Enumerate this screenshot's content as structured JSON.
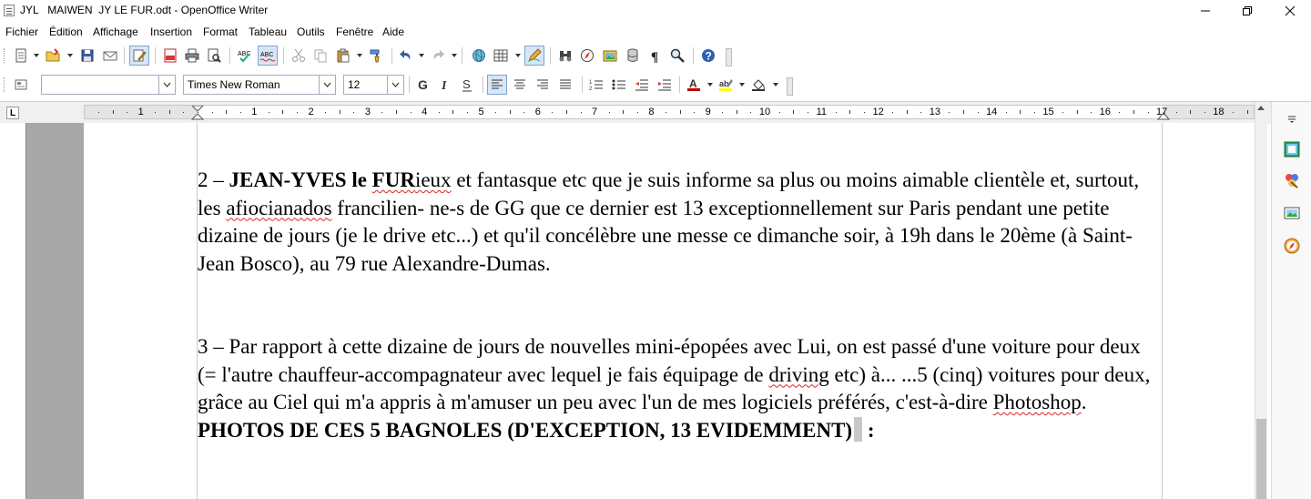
{
  "window": {
    "title": "JYL   MAIWEN  JY LE FUR.odt - OpenOffice Writer"
  },
  "menu": [
    "Fichier",
    "Édition",
    "Affichage",
    "Insertion",
    "Format",
    "Tableau",
    "Outils",
    "Fenêtre",
    "Aide"
  ],
  "formatting": {
    "style_value": "",
    "font_name": "Times New Roman",
    "font_size": "12"
  },
  "ruler": {
    "labels": [
      "1",
      "1",
      "2",
      "3",
      "4",
      "5",
      "6",
      "7",
      "8",
      "9",
      "10",
      "11",
      "12",
      "13",
      "14",
      "15",
      "16",
      "17",
      "18"
    ]
  },
  "document": {
    "p2": {
      "lead": "2 – ",
      "bold": "JEAN-YVES le ",
      "bold_squiggle": "FUR",
      "squiggle_rest": "ieux",
      "text1": " et fantasque etc que je suis informe sa plus ou moins aimable clientèle et, surtout, les ",
      "squiggle2": "afiocianados",
      "text2": " francilien- ne-s de GG que ce dernier est 13 exceptionnellement sur Paris pendant une petite dizaine de jours (je le drive etc...) et qu'il concélèbre une messe ce dimanche soir, à 19h dans le 20ème (à Saint-Jean Bosco), au 79 rue Alexandre-Dumas."
    },
    "p3": {
      "text1": "3 – Par rapport à cette dizaine de jours de nouvelles mini-épopées avec Lui, on est passé d'une voiture pour deux (= l'autre chauffeur-accompagnateur avec lequel je fais équipage de ",
      "squiggle1": "driving",
      "text2": " etc) à... ...5 (cinq) voitures pour deux, grâce au Ciel qui m'a appris à m'amuser un peu avec l'un de mes logiciels préférés, c'est-à-dire ",
      "squiggle2": "Photoshop",
      "text3": "."
    },
    "heading": {
      "text": "PHOTOS DE CES 5 BAGNOLES (D'EXCEPTION, 13 EVIDEMMENT)",
      "colon": " :"
    }
  },
  "colors": {
    "accent": "#7da2ce",
    "spellcheck": "#d22222"
  }
}
